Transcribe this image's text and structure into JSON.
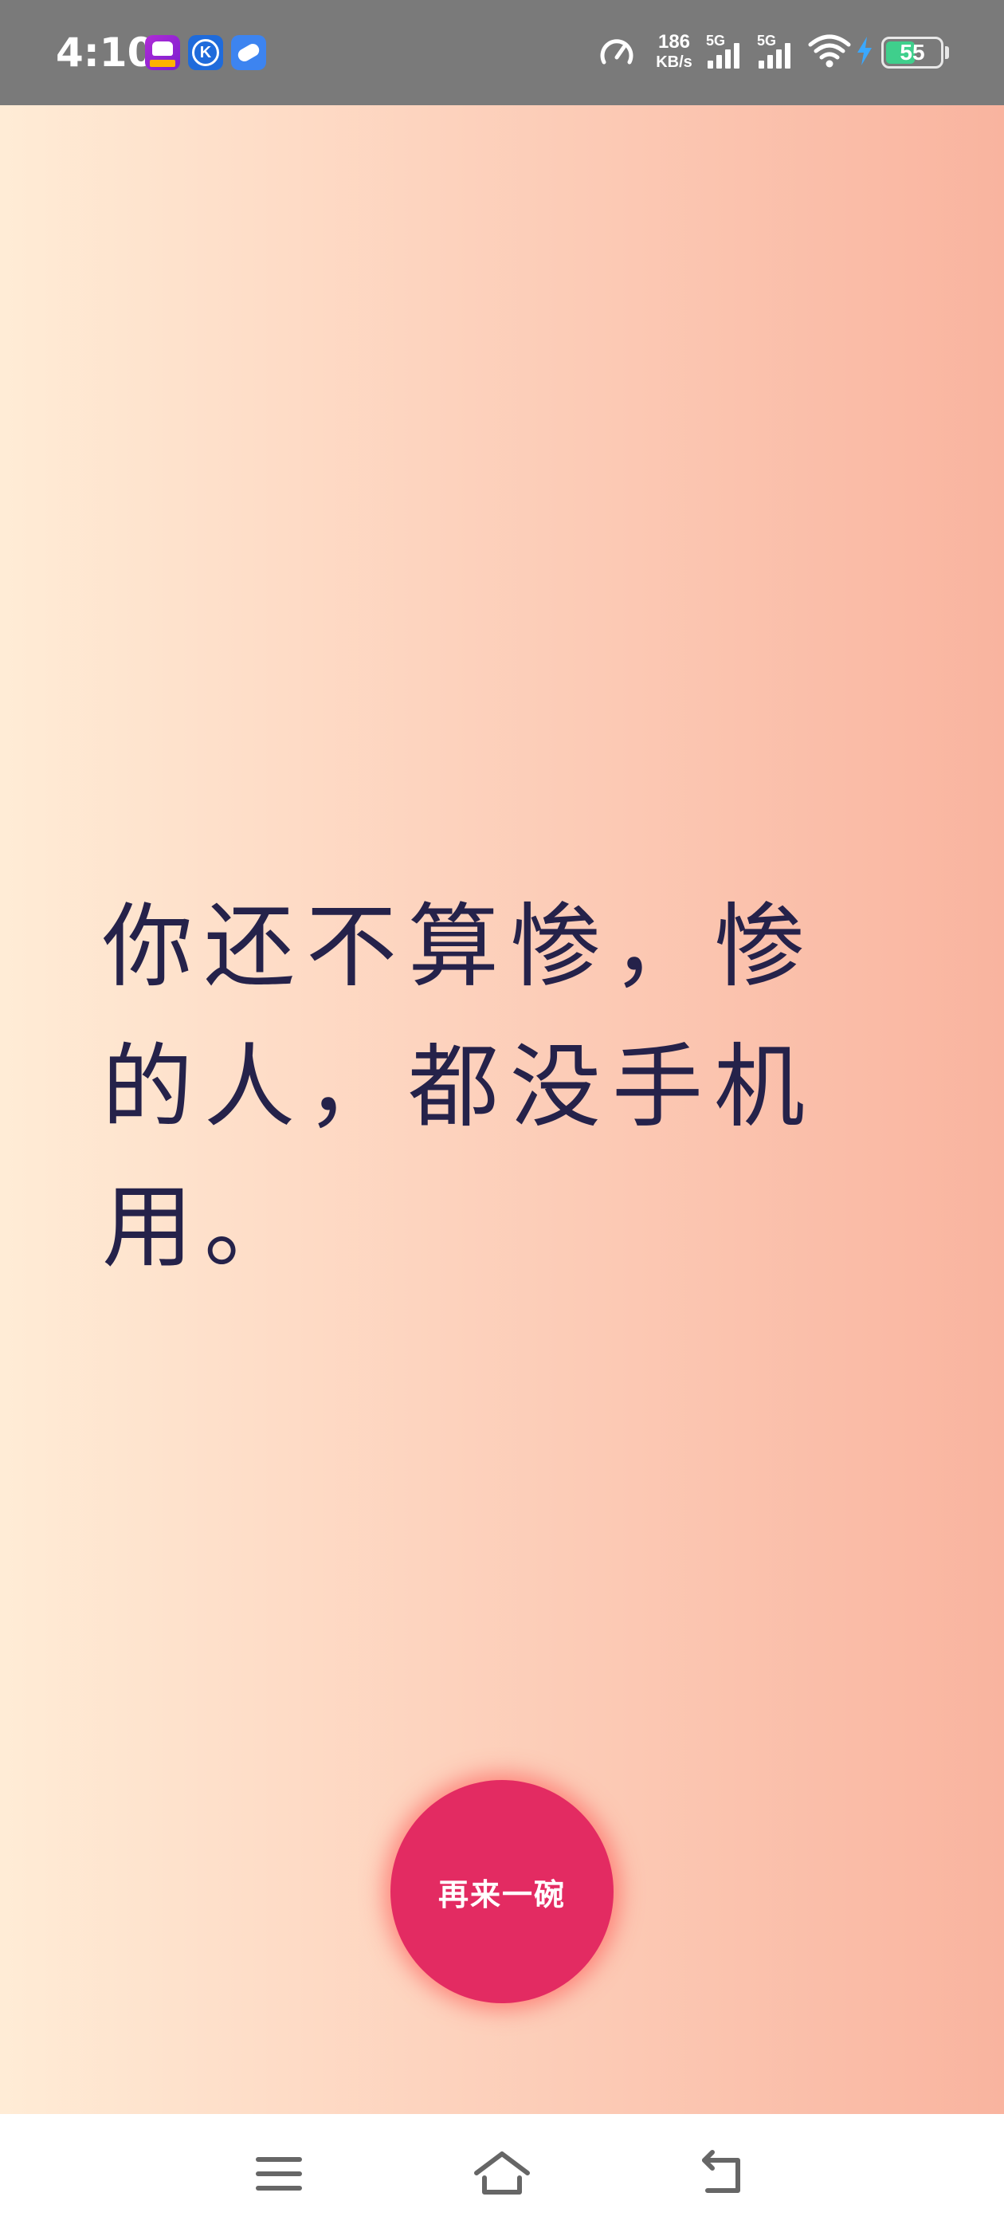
{
  "status_bar": {
    "time": "4:10",
    "network_speed_value": "186",
    "network_speed_unit": "KB/s",
    "sim1_type": "5G",
    "sim2_type": "5G",
    "battery_level": "55",
    "battery_fraction": 0.55,
    "charging": true,
    "notification_icons": [
      "game-app-icon",
      "k-app-icon",
      "pill-app-icon"
    ]
  },
  "main": {
    "quote_text": "你还不算惨，惨的人，都没手机用。",
    "again_button_label": "再来一碗"
  },
  "nav_bar": {
    "buttons": [
      "menu-icon",
      "home-icon",
      "back-icon"
    ]
  },
  "colors": {
    "background_gradient": [
      "#ffecd6",
      "#fdd2bd",
      "#f9b49f"
    ],
    "quote_text": "#25224a",
    "button": "#e32b62",
    "status_bar": "#7a7a7a"
  }
}
